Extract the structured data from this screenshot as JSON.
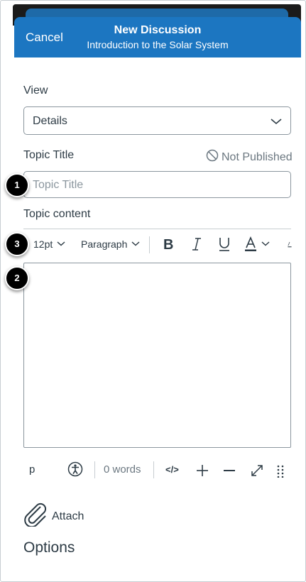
{
  "header": {
    "cancel_label": "Cancel",
    "title": "New Discussion",
    "subtitle": "Introduction to the Solar System",
    "color": "#1c76c1"
  },
  "view": {
    "label": "View",
    "selected": "Details"
  },
  "topic_title": {
    "label": "Topic Title",
    "status": "Not Published",
    "placeholder": "Topic Title"
  },
  "topic_content": {
    "label": "Topic content"
  },
  "toolbar": {
    "font_size": "12pt",
    "block_format": "Paragraph",
    "icons": [
      "bold-icon",
      "italic-icon",
      "underline-icon",
      "text-color-icon"
    ]
  },
  "status_bar": {
    "path": "p",
    "word_count": "0 words",
    "icons": [
      "accessibility-icon",
      "html-editor-icon",
      "zoom-in-icon",
      "zoom-out-icon",
      "fullscreen-icon",
      "resize-handle-icon"
    ]
  },
  "attach_label": "Attach",
  "options_label": "Options",
  "callouts": [
    "1",
    "2",
    "3"
  ]
}
